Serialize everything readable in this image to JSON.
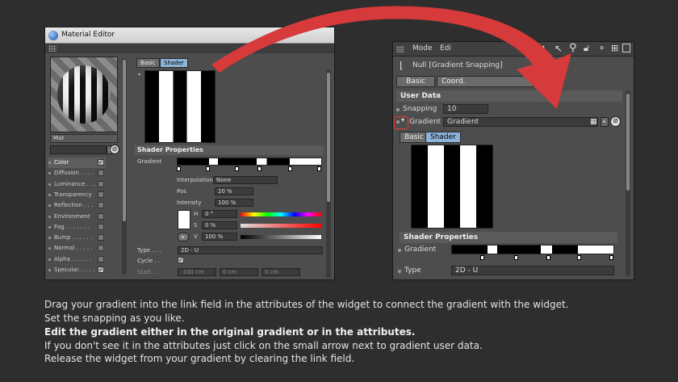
{
  "material_editor": {
    "title": "Material Editor",
    "material_name": "Mat",
    "channels": [
      {
        "label": "Color",
        "checked": true,
        "selected": true
      },
      {
        "label": "Diffusion . . . .",
        "checked": false
      },
      {
        "label": "Luminance . . .",
        "checked": false
      },
      {
        "label": "Transparency",
        "checked": false
      },
      {
        "label": "Reflection . . .",
        "checked": false
      },
      {
        "label": "Environment",
        "checked": false
      },
      {
        "label": "Fog . . . . . . .",
        "checked": false
      },
      {
        "label": "Bump . . . . . .",
        "checked": false
      },
      {
        "label": "Normal . . . . .",
        "checked": false
      },
      {
        "label": "Alpha . . . . . .",
        "checked": false
      },
      {
        "label": "Specular. . . . .",
        "checked": true
      }
    ],
    "tabs": [
      "Basic",
      "Shader"
    ],
    "active_tab": "Shader",
    "shader_properties_label": "Shader Properties",
    "gradient_label": "Gradient",
    "interpolation_label": "Interpolation",
    "interpolation_value": "None",
    "pos_label": "Pos",
    "pos_value": "20 %",
    "intensity_label": "Intensity",
    "intensity_value": "100 %",
    "h_label": "H",
    "h_value": "0 °",
    "s_label": "S",
    "s_value": "0 %",
    "v_label": "V",
    "v_value": "100 %",
    "type_label": "Type . . .",
    "type_value": "2D - U",
    "cycle_label": "Cycle . .",
    "start_label": "Start. . .",
    "start_values": [
      "-100 cm",
      "0 cm",
      "0 cm"
    ]
  },
  "attributes": {
    "mode_label": "Mode",
    "edit_label": "Edi",
    "object_title": "Null [Gradient Snapping]",
    "tabs": [
      "Basic",
      "Coord."
    ],
    "user_data_label": "User Data",
    "snapping_label": "Snapping",
    "snapping_value": "10",
    "gradient_label": "Gradient",
    "gradient_link_value": "Gradient",
    "inner_tabs": [
      "Basic",
      "Shader"
    ],
    "inner_active_tab": "Shader",
    "shader_properties_label": "Shader Properties",
    "shader_gradient_label": "Gradient",
    "type_label": "Type",
    "type_value": "2D - U"
  },
  "captions": [
    "Drag your gradient into the link field in the attributes of the widget to connect the gradient with the widget.",
    "Set the snapping as you like.",
    "Edit the gradient either in the original gradient or in the attributes.",
    "If you don't see it in the attributes just click on the small arrow next to gradient user data.",
    "Release the widget from your gradient by clearing the link field."
  ],
  "colors": {
    "background": "#2e2e2e",
    "panel": "#4d4d4d",
    "active_tab": "#8db3d8",
    "arrow": "#d63a3a",
    "highlight_circle": "#e23a3a"
  }
}
